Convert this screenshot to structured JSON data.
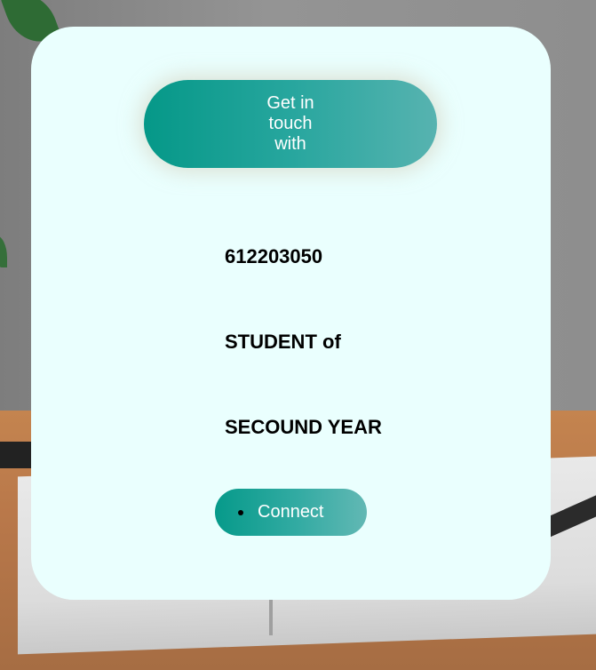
{
  "card": {
    "button_label": "Get in touch with",
    "lines": [
      "612203050",
      "STUDENT of",
      "SECOUND YEAR"
    ],
    "connect_label": "Connect"
  },
  "colors": {
    "card_background": "#eafffe",
    "accent_start": "#059888",
    "accent_end": "#57b3b0",
    "text": "#000000",
    "button_text": "#ffffff"
  }
}
